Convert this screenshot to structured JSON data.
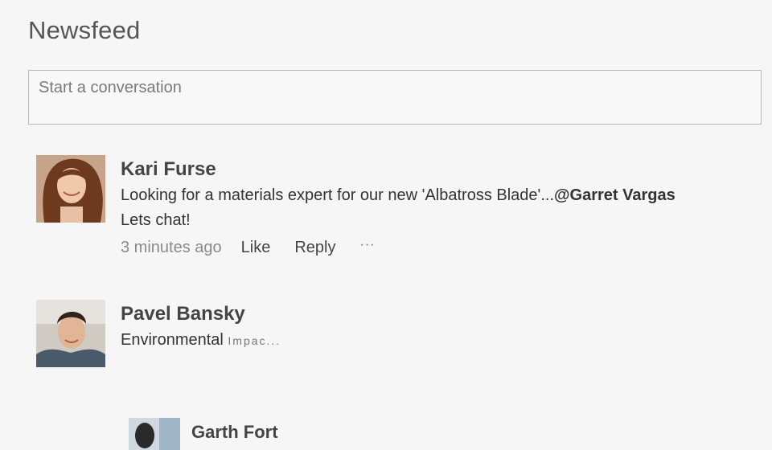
{
  "page": {
    "title": "Newsfeed"
  },
  "composer": {
    "placeholder": "Start a conversation"
  },
  "posts": [
    {
      "author": "Kari Furse",
      "message_prefix": "Looking for a materials expert for our new 'Albatross Blade'...",
      "mention": "@Garret Vargas",
      "message_line2": "Lets chat!",
      "timestamp": "3 minutes ago",
      "like_label": "Like",
      "reply_label": "Reply",
      "more_label": "···"
    },
    {
      "author": "Pavel Bansky",
      "message": "Environmental",
      "message_fading": "Impac..."
    },
    {
      "author": "Garth Fort"
    }
  ],
  "colors": {
    "background": "#f6f6f6",
    "composer_border": "#b8b8b8",
    "text_primary": "#333333",
    "text_muted": "#8a8a8a"
  }
}
